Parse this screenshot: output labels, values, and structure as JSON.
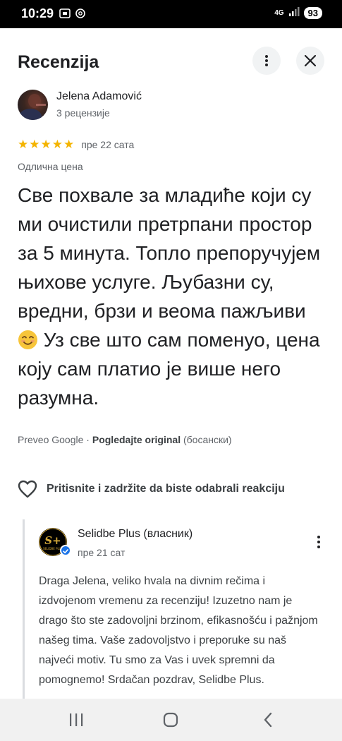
{
  "status_bar": {
    "time": "10:29",
    "network": "4G",
    "battery": "93"
  },
  "header": {
    "title": "Recenzija",
    "more_icon": "more-vert-icon",
    "close_icon": "close-icon"
  },
  "review": {
    "reviewer_name": "Jelena Adamović",
    "reviewer_reviews": "3 рецензије",
    "rating": 5,
    "time_ago": "пре 22 сата",
    "price_label": "Одлична цена",
    "text_part1": "Све похвале за младиће који су ми очистили претрпани простор за 5 минута. Топло препоручујем њихове услуге. Љубазни су, вредни, брзи и веома пажљиви",
    "text_part2": " Уз све што сам поменуо, цена коју сам платио је више него разумна.",
    "translated_by": "Preveo Google",
    "separator": " · ",
    "view_original": "Pogledajte original",
    "original_language": " (босански)"
  },
  "reaction": {
    "label": "Pritisnite i zadržite da biste odabrali reakciju",
    "icon": "heart-outline-icon"
  },
  "owner_reply": {
    "name": "Selidbe Plus (власник)",
    "time_ago": "пре 21 сат",
    "logo_text": "S+",
    "logo_subtext": "SELIDBE PLUS",
    "text": "Draga Jelena, veliko hvala na divnim rečima i izdvojenom vremenu za recenziju! Izuzetno nam je drago što ste zadovoljni brzinom, efikasnošću i pažnjom našeg tima. Vaše zadovoljstvo i preporuke su naš najveći motiv. Tu smo za Vas i uvek spremni da pomognemo! Srdačan pozdrav, Selidbe Plus."
  },
  "colors": {
    "star": "#f4b400",
    "text_primary": "#202124",
    "text_secondary": "#5f6368",
    "verified": "#1a73e8"
  }
}
